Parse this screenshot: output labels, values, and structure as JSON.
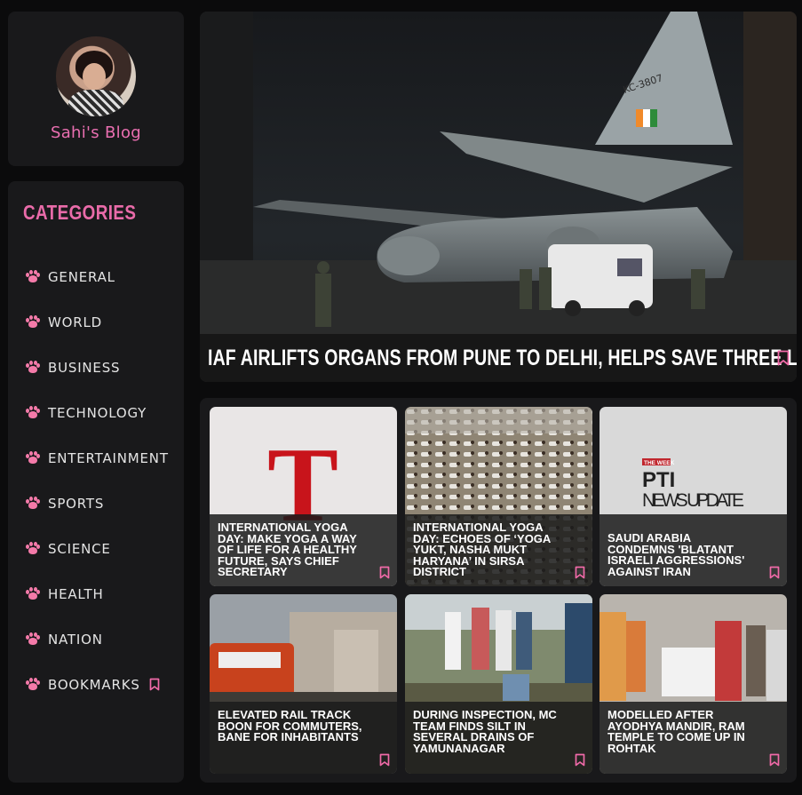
{
  "profile": {
    "blog_name": "Sahi's Blog"
  },
  "sidebar": {
    "title": "CATEGORIES",
    "items": [
      {
        "label": "GENERAL"
      },
      {
        "label": "WORLD"
      },
      {
        "label": "BUSINESS"
      },
      {
        "label": "TECHNOLOGY"
      },
      {
        "label": "ENTERTAINMENT"
      },
      {
        "label": "SPORTS"
      },
      {
        "label": "SCIENCE"
      },
      {
        "label": "HEALTH"
      },
      {
        "label": "NATION"
      },
      {
        "label": "BOOKMARKS"
      }
    ]
  },
  "hero": {
    "title": "IAF AIRLIFTS ORGANS FROM PUNE TO DELHI, HELPS SAVE THREE LIVES",
    "aircraft_tail": "KC-3807"
  },
  "articles": [
    {
      "title": "INTERNATIONAL YOGA DAY: MAKE YOGA A WAY OF LIFE FOR A HEALTHY FUTURE, SAYS CHIEF SECRETARY",
      "thumb_text": "T"
    },
    {
      "title": "INTERNATIONAL YOGA DAY: ECHOES OF ‘YOGA YUKT, NASHA MUKT HARYANA’ IN SIRSA DISTRICT"
    },
    {
      "title": "SAUDI ARABIA CONDEMNS 'BLATANT ISRAELI AGGRESSIONS' AGAINST IRAN",
      "thumb_top": "THE WEEK",
      "thumb_mid": "PTI",
      "thumb_bottom": "NEWS UPDATE"
    },
    {
      "title": "ELEVATED RAIL TRACK BOON FOR COMMUTERS, BANE FOR INHABITANTS"
    },
    {
      "title": "DURING INSPECTION, MC TEAM FINDS SILT IN SEVERAL DRAINS OF YAMUNANAGAR"
    },
    {
      "title": "MODELLED AFTER AYODHYA MANDIR, RAM TEMPLE TO COME UP IN ROHTAK"
    }
  ],
  "colors": {
    "accent": "#e96ba9",
    "paw": "#f47aa9",
    "panel": "#19191b",
    "background": "#0b0b0c"
  }
}
